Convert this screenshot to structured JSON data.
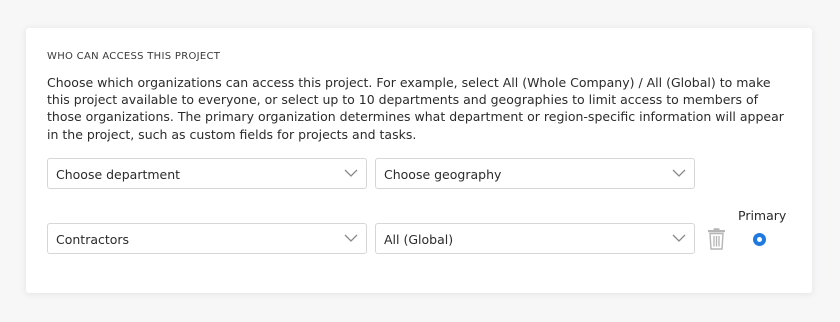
{
  "section": {
    "title": "WHO CAN ACCESS THIS PROJECT",
    "description": "Choose which organizations can access this project. For example, select All (Whole Company) / All (Global) to make this project available to everyone, or select up to 10 departments and geographies to limit access to members of those organizations. The primary organization determines what department or region-specific information will appear in the project, such as custom fields for projects and tasks."
  },
  "new_row": {
    "department_placeholder": "Choose department",
    "geography_placeholder": "Choose geography"
  },
  "rows": [
    {
      "department": "Contractors",
      "geography": "All (Global)",
      "primary": true
    }
  ],
  "primary_label": "Primary",
  "colors": {
    "accent": "#1f7ae0",
    "border": "#d6d6d6",
    "text": "#2b2b2b"
  },
  "icons": {
    "dropdown": "chevron-down-icon",
    "delete": "trash-icon",
    "radio": "radio-selected-icon"
  }
}
